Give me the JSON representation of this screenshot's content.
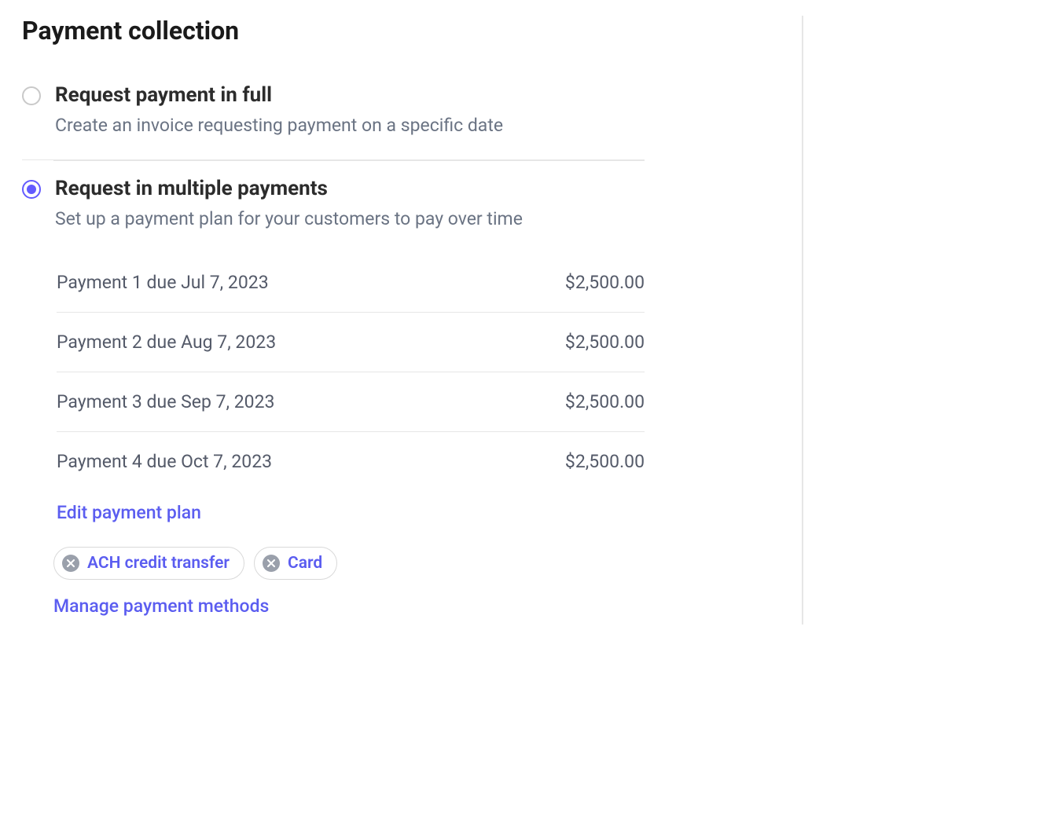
{
  "section_title": "Payment collection",
  "options": {
    "full": {
      "title": "Request payment in full",
      "desc": "Create an invoice requesting payment on a specific date",
      "selected": false
    },
    "multiple": {
      "title": "Request in multiple payments",
      "desc": "Set up a payment plan for your customers to pay over time",
      "selected": true
    }
  },
  "payments": [
    {
      "label": "Payment 1 due Jul 7, 2023",
      "amount": "$2,500.00"
    },
    {
      "label": "Payment 2 due Aug 7, 2023",
      "amount": "$2,500.00"
    },
    {
      "label": "Payment 3 due Sep 7, 2023",
      "amount": "$2,500.00"
    },
    {
      "label": "Payment 4 due Oct 7, 2023",
      "amount": "$2,500.00"
    }
  ],
  "edit_plan_label": "Edit payment plan",
  "payment_methods": [
    {
      "label": "ACH credit transfer"
    },
    {
      "label": "Card"
    }
  ],
  "manage_methods_label": "Manage payment methods"
}
